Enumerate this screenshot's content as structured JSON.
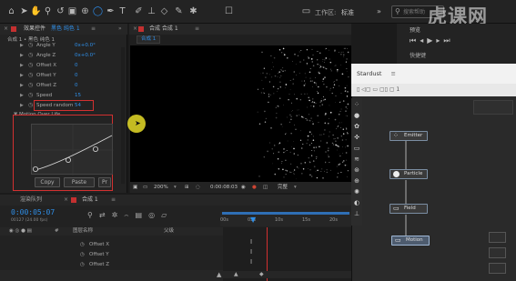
{
  "toolbar": {
    "workspace_label": "工作区:",
    "workspace_value": "标准",
    "search_placeholder": "搜索帮助"
  },
  "watermark": {
    "logo_text": "虎课网"
  },
  "effects_panel": {
    "tab_title": "效果控件",
    "tab_layer": "黑色 纯色 1",
    "breadcrumb": "合成 1 • 黑色 纯色 1",
    "properties": [
      {
        "name": "Angle Y",
        "value": "0x+0.0°"
      },
      {
        "name": "Angle Z",
        "value": "0x+0.0°"
      },
      {
        "name": "Offset X",
        "value": "0"
      },
      {
        "name": "Offset Y",
        "value": "0"
      },
      {
        "name": "Offset Z",
        "value": "0"
      },
      {
        "name": "Speed",
        "value": "15"
      },
      {
        "name": "Speed random",
        "value": "54"
      }
    ],
    "motion_over_life_label": "Motion Over Life",
    "copy_label": "Copy",
    "paste_label": "Paste",
    "preset_label": "Pr"
  },
  "composition": {
    "header": "合成 合成 1",
    "tab": "合成 1",
    "zoom": "200%",
    "time": "0:00:08:03",
    "quality": "完整"
  },
  "preview": {
    "title": "预览",
    "shortcut_label": "快捷键"
  },
  "stardust": {
    "title": "Stardust",
    "toolbar_text": "▯ ◁▢ ▭ ▢▯ ▢ 1",
    "nodes": [
      {
        "label": "Emitter"
      },
      {
        "label": "Particle"
      },
      {
        "label": "Field"
      },
      {
        "label": "Motion"
      }
    ]
  },
  "timeline": {
    "tab_render": "渲染队列",
    "tab_comp": "合成 1",
    "timecode": "0:00:05:07",
    "fps": "00127 (24.00 fps)",
    "col_name": "图层名称",
    "col_parent": "父级",
    "rows": [
      "Offset X",
      "Offset Y",
      "Offset Z"
    ],
    "ruler_ticks": [
      "00s",
      "05s",
      "10s",
      "15s",
      "20s"
    ]
  }
}
